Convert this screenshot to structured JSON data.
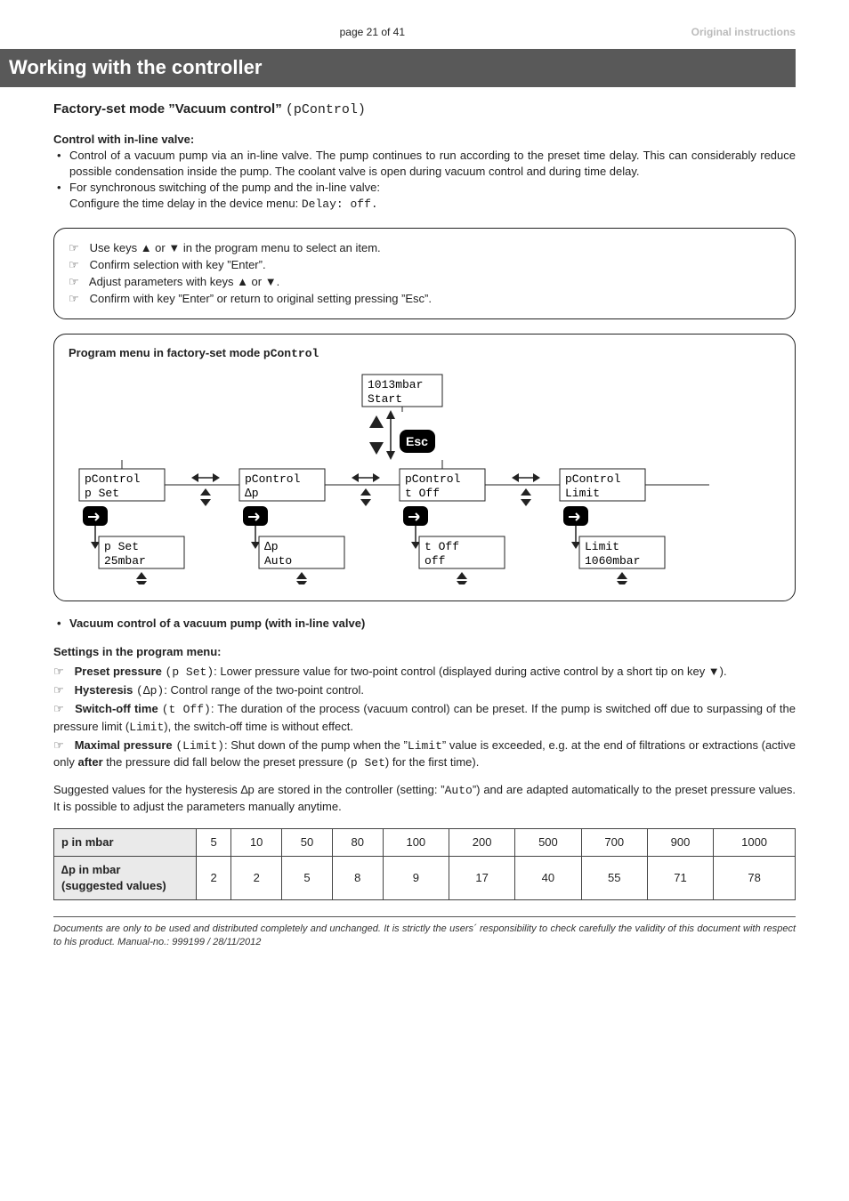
{
  "header": {
    "page_num": "page 21 of 41",
    "right": "Original instructions"
  },
  "banner": "Working with the controller",
  "subtitle_prefix": "Factory-set mode ”Vacuum control” ",
  "subtitle_code": "(pControl)",
  "control_heading": "Control with in-line valve:",
  "control_b1": "Control of a vacuum pump via an in-line valve. The pump continues to run according to the preset time delay. This can considerably reduce possible condensation inside the pump. The coolant valve is open during vacuum control and during time delay.",
  "control_b2a": "For synchronous switching of the pump and the in-line valve:",
  "control_b2b": "Configure the time delay in the device menu:  ",
  "control_b2b_code": "Delay: off.",
  "box1": {
    "l1a": "Use keys ▲ or ▼ in the program menu to select an item.",
    "l2": "Confirm selection with key ”Enter”.",
    "l3": "Adjust parameters with keys ▲ or ▼.",
    "l4": "Confirm with key ”Enter” or return to original setting pressing ”Esc”."
  },
  "diagram": {
    "title_a": "Program menu in factory-set mode ",
    "title_code": "pControl",
    "top1": "1013mbar",
    "top2": "Start",
    "esc": "Esc",
    "c1a": "pControl",
    "c1b": "p Set",
    "c1c": "p Set",
    "c1d": "25mbar",
    "c2a": "pControl",
    "c2b": "∆p",
    "c2c": "∆p",
    "c2d": "Auto",
    "c3a": "pControl",
    "c3b": "t Off",
    "c3c": "t Off",
    "c3d": "off",
    "c4a": "pControl",
    "c4b": "Limit",
    "c4c": "Limit",
    "c4d": "1060mbar"
  },
  "bullet_mid": "Vacuum control of a vacuum pump (with in-line valve)",
  "settings_head": "Settings in the program menu:",
  "s1_a": "Preset pressure",
  "s1_code": "(p Set)",
  "s1_b": ": Lower pressure value for two-point control (displayed during active control by a short tip on key ▼).",
  "s2_a": "Hysteresis",
  "s2_code": "(∆p)",
  "s2_b": ": Control range of the two-point control.",
  "s3_a": "Switch-off time",
  "s3_code": "(t Off)",
  "s3_b": ": The duration of the process (vacuum control) can be preset. If the pump is switched off due to surpassing of the pressure limit (",
  "s3_code2": "Limit",
  "s3_c": "), the switch-off time is without effect.",
  "s4_a": "Maximal pressure",
  "s4_code": "(Limit)",
  "s4_b": ": Shut down of the pump when the ”",
  "s4_code2": "Limit",
  "s4_c": "” value is exceeded, e.g. at the end of filtrations or extractions (active only ",
  "s4_bold": "after",
  "s4_d": " the pressure did fall below the preset pressure (",
  "s4_code3": "p Set",
  "s4_e": ") for the first time).",
  "para_vals_a": "Suggested values for the hysteresis ∆p are stored in the controller (setting: ”",
  "para_vals_code": "Auto",
  "para_vals_b": "”) and are adapted automatically to the preset pressure values. It is possible to adjust the parameters manually anytime.",
  "table": {
    "row1_head": "p in mbar",
    "row2_head_a": "∆p in mbar",
    "row2_head_b": "(suggested values)",
    "p": [
      "5",
      "10",
      "50",
      "80",
      "100",
      "200",
      "500",
      "700",
      "900",
      "1000"
    ],
    "dp": [
      "2",
      "2",
      "5",
      "8",
      "9",
      "17",
      "40",
      "55",
      "71",
      "78"
    ]
  },
  "footer": "Documents are only to be used and distributed completely and unchanged. It is strictly the users´ responsibility to check carefully the validity of this document with respect to his product. Manual-no.: 999199 / 28/11/2012"
}
